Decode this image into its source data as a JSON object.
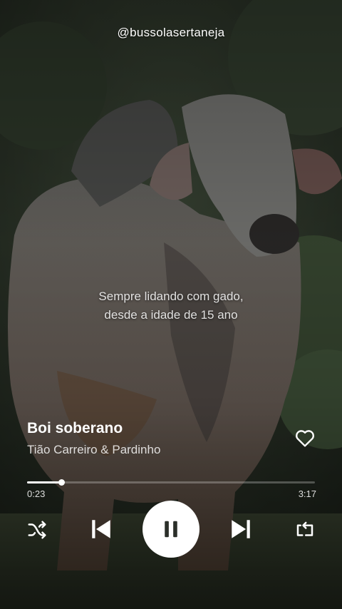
{
  "watermark": "@bussolasertaneja",
  "lyrics": {
    "line1": "Sempre lidando com gado,",
    "line2": "desde a idade de 15 ano"
  },
  "track": {
    "title": "Boi soberano",
    "artist": "Tião Carreiro & Pardinho",
    "liked": false
  },
  "playback": {
    "current_time": "0:23",
    "total_time": "3:17",
    "progress": 0.12,
    "state": "playing"
  },
  "icons": {
    "like": "heart-outline-icon",
    "shuffle": "shuffle-icon",
    "previous": "skip-previous-icon",
    "play_pause": "pause-icon",
    "next": "skip-next-icon",
    "repeat": "repeat-icon"
  },
  "colors": {
    "accent": "#ffffff",
    "play_button_bg": "#ffffff",
    "play_icon": "#2b2f2a"
  }
}
